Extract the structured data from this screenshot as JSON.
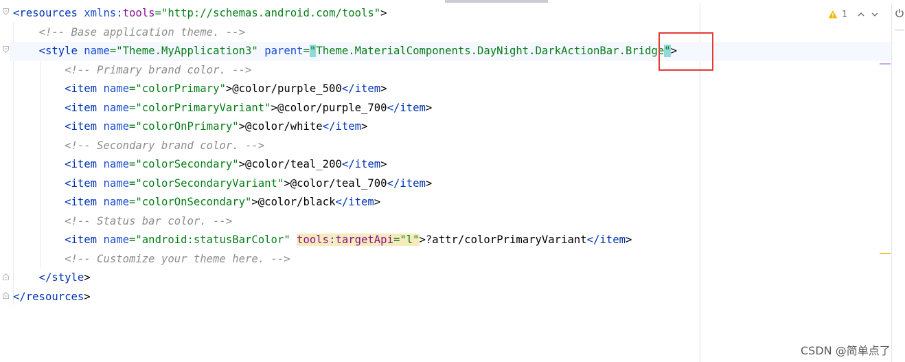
{
  "inspection": {
    "warning_count": "1"
  },
  "colors": {
    "tag": "#0033b3",
    "attribute": "#174ad4",
    "namespace": "#871094",
    "value": "#067d17",
    "comment": "#8c8c8c",
    "highlight_box": "#e53935"
  },
  "code": {
    "l1": {
      "open": "<",
      "tag": "resources",
      "sp": " ",
      "attr_ns": "xmlns",
      "colon": ":",
      "attr": "tools",
      "eq": "=",
      "value": "\"http://schemas.android.com/tools\"",
      "close": ">"
    },
    "l2": {
      "comment": "<!-- Base application theme. -->"
    },
    "l3": {
      "open": "<",
      "tag": "style",
      "attr1": "name",
      "eq1": "=",
      "val1": "\"Theme.MyApplication3\"",
      "attr2": "parent",
      "eq2": "=",
      "q_open": "\"",
      "val2": "Theme.MaterialComponents.DayNight.DarkActionBar.Bridge",
      "q_close": "\"",
      "close": ">"
    },
    "l4": {
      "comment": "<!-- Primary brand color. -->"
    },
    "l5": {
      "tag": "item",
      "attr": "name",
      "val": "\"colorPrimary\"",
      "text": "@color/purple_500",
      "end_tag": "item"
    },
    "l6": {
      "tag": "item",
      "attr": "name",
      "val": "\"colorPrimaryVariant\"",
      "text": "@color/purple_700",
      "end_tag": "item"
    },
    "l7": {
      "tag": "item",
      "attr": "name",
      "val": "\"colorOnPrimary\"",
      "text": "@color/white",
      "end_tag": "item"
    },
    "l8": {
      "comment": "<!-- Secondary brand color. -->"
    },
    "l9": {
      "tag": "item",
      "attr": "name",
      "val": "\"colorSecondary\"",
      "text": "@color/teal_200",
      "end_tag": "item"
    },
    "l10": {
      "tag": "item",
      "attr": "name",
      "val": "\"colorSecondaryVariant\"",
      "text": "@color/teal_700",
      "end_tag": "item"
    },
    "l11": {
      "tag": "item",
      "attr": "name",
      "val": "\"colorOnSecondary\"",
      "text": "@color/black",
      "end_tag": "item"
    },
    "l12": {
      "comment": "<!-- Status bar color. -->"
    },
    "l13": {
      "tag": "item",
      "attr": "name",
      "val": "\"android:statusBarColor\"",
      "attr2_ns": "tools",
      "attr2": "targetApi",
      "val2": "\"l\"",
      "text": "?attr/colorPrimaryVariant",
      "end_tag": "item"
    },
    "l14": {
      "comment": "<!-- Customize your theme here. -->"
    },
    "l15": {
      "end_tag": "style"
    },
    "l16": {
      "end_tag": "resources"
    }
  },
  "watermark": "CSDN @简单点了"
}
